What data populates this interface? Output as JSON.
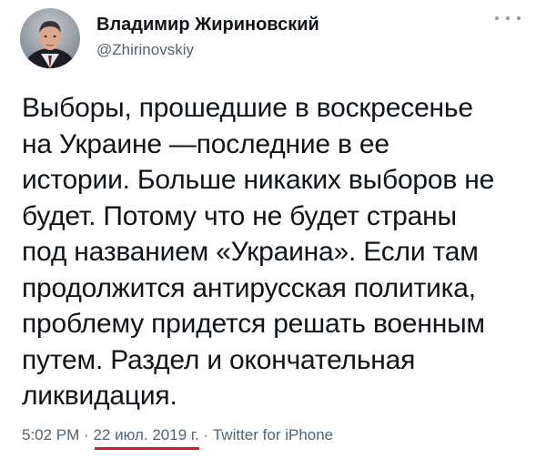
{
  "author": {
    "display_name": "Владимир Жириновский",
    "handle": "@Zhirinovskiy"
  },
  "tweet": {
    "lines": [
      "Выборы, прошедшие в воскресенье",
      "на Украине —последние в ее",
      "истории. Больше никаких выборов не",
      "будет. Потому что не будет страны",
      "под названием «Украина». Если там",
      "продолжится антирусская политика,",
      "проблему придется решать военным",
      "путем. Раздел и окончательная",
      "ликвидация."
    ]
  },
  "meta": {
    "time": "5:02 PM",
    "separator": "·",
    "date": "22 июл. 2019 г.",
    "source": "Twitter for iPhone"
  },
  "icons": {
    "avatar": "avatar-photo",
    "more": "more-options-icon"
  },
  "colors": {
    "text": "#0f1419",
    "secondary": "#536471",
    "underline": "#d21f1f"
  }
}
